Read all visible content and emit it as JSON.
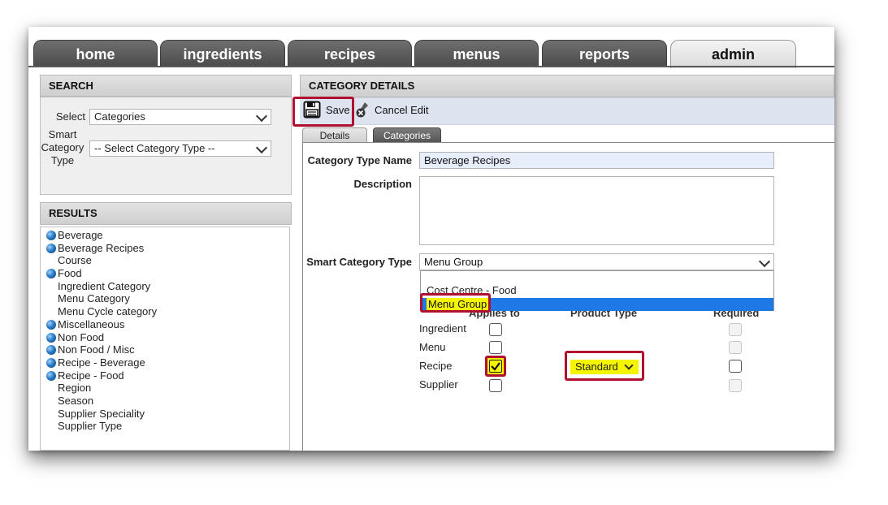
{
  "nav": {
    "tabs": [
      {
        "label": "home"
      },
      {
        "label": "ingredients"
      },
      {
        "label": "recipes"
      },
      {
        "label": "menus"
      },
      {
        "label": "reports"
      },
      {
        "label": "admin"
      }
    ],
    "active_tab": "admin"
  },
  "search": {
    "header": "SEARCH",
    "select_label": "Select",
    "select_value": "Categories",
    "smart_label": [
      "Smart",
      "Category",
      "Type"
    ],
    "smart_value": "-- Select Category Type --"
  },
  "results": {
    "header": "RESULTS",
    "items": [
      {
        "label": "Beverage",
        "icon": "globe-icon"
      },
      {
        "label": "Beverage Recipes",
        "icon": "globe-icon"
      },
      {
        "label": "Course",
        "icon": ""
      },
      {
        "label": "Food",
        "icon": "globe-icon"
      },
      {
        "label": "Ingredient Category",
        "icon": ""
      },
      {
        "label": "Menu Category",
        "icon": ""
      },
      {
        "label": "Menu Cycle category",
        "icon": ""
      },
      {
        "label": "Miscellaneous",
        "icon": "globe-icon"
      },
      {
        "label": "Non Food",
        "icon": "globe-icon"
      },
      {
        "label": "Non Food / Misc",
        "icon": "globe-icon"
      },
      {
        "label": "Recipe - Beverage",
        "icon": "globe-icon"
      },
      {
        "label": "Recipe - Food",
        "icon": "globe-icon"
      },
      {
        "label": "Region",
        "icon": ""
      },
      {
        "label": "Season",
        "icon": ""
      },
      {
        "label": "Supplier Speciality",
        "icon": ""
      },
      {
        "label": "Supplier Type",
        "icon": ""
      }
    ]
  },
  "details": {
    "header": "CATEGORY DETAILS",
    "toolbar": {
      "save_label": "Save",
      "cancel_label": "Cancel Edit"
    },
    "tabs": [
      "Details",
      "Categories"
    ],
    "form": {
      "name_label": "Category Type Name",
      "name_value": "Beverage Recipes",
      "description_label": "Description",
      "description_value": "",
      "smart_label": "Smart Category Type",
      "smart_value": "Menu Group",
      "dropdown_options": [
        "",
        "Cost Centre - Food",
        "Menu Group"
      ],
      "highlighted_option": "Menu Group"
    },
    "grid": {
      "headers": [
        "Applies to",
        "Product Type",
        "Required"
      ],
      "rows": [
        {
          "label": "Ingredient",
          "applies": false,
          "required_enabled": false
        },
        {
          "label": "Menu",
          "applies": false,
          "required_enabled": false
        },
        {
          "label": "Recipe",
          "applies": true,
          "product_type": "Standard",
          "required_enabled": true
        },
        {
          "label": "Supplier",
          "applies": false,
          "required_enabled": false
        }
      ]
    }
  },
  "colors": {
    "highlight_yellow": "#f5f500",
    "annotation_red": "#b01030",
    "dropdown_selected": "#1e78e6"
  }
}
